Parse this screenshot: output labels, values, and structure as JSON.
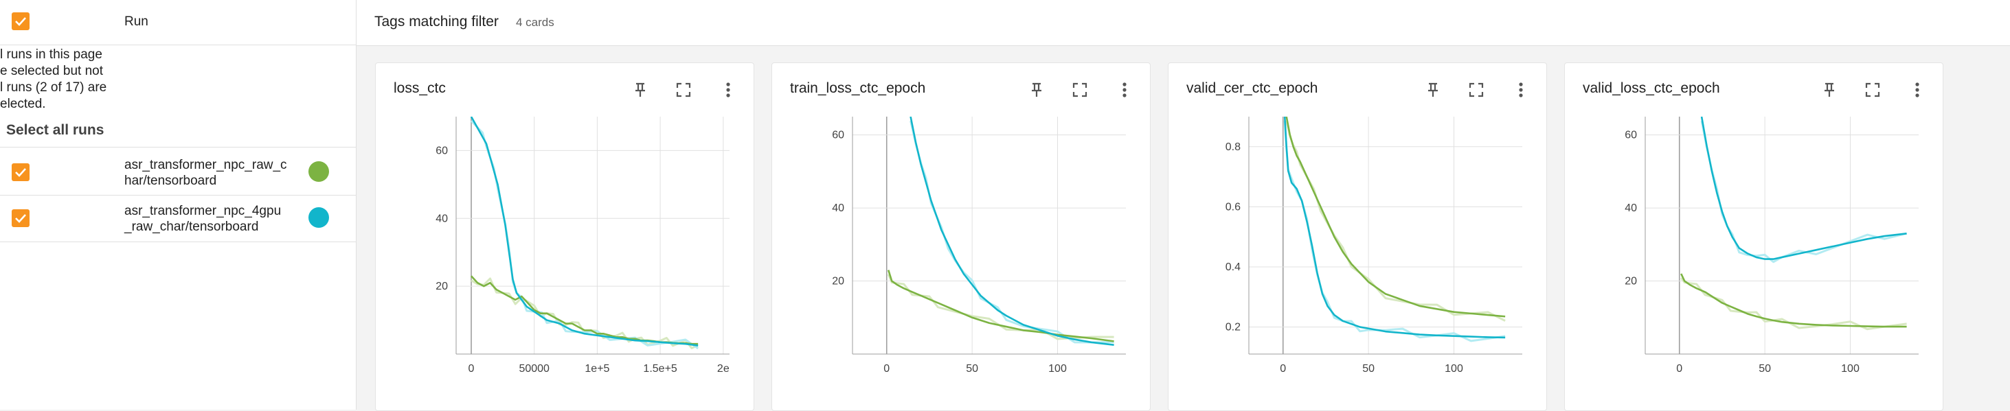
{
  "sidebar": {
    "header": {
      "label": "Run"
    },
    "notice": [
      "l runs in this page",
      "e selected but not",
      "l runs (2 of 17) are",
      "elected."
    ],
    "select_all": "Select all runs",
    "runs": [
      {
        "name_lines": [
          "asr_transformer_npc_raw_c",
          "har/tensorboard"
        ],
        "color": "#7cb342"
      },
      {
        "name_lines": [
          "asr_transformer_npc_4gpu",
          "_raw_char/tensorboard"
        ],
        "color": "#12b5cb"
      }
    ]
  },
  "topbar": {
    "title": "Tags matching filter",
    "count": "4 cards"
  },
  "colors": {
    "accent": "#f7931e",
    "run1": "#7cb342",
    "run2": "#12b5cb",
    "run1_light": "#d7e8c0",
    "run2_light": "#b2ebf2"
  },
  "icons": {
    "pin": "pin-icon",
    "fullscreen": "fullscreen-icon",
    "menu": "more-vert-icon"
  },
  "chart_data": [
    {
      "type": "line",
      "title": "loss_ctc",
      "xlim": [
        -12000,
        205000
      ],
      "ylim": [
        0,
        70
      ],
      "x_ticks": [
        0,
        50000,
        100000,
        150000,
        200000
      ],
      "x_tick_labels": [
        "0",
        "50000",
        "1e+5",
        "1.5e+5",
        "2e"
      ],
      "y_ticks": [
        0,
        20,
        40,
        60
      ],
      "y_tick_labels": [
        "",
        "20",
        "40",
        "60"
      ],
      "grid": true,
      "series": [
        {
          "color_key": "run1",
          "x": [
            0,
            5000,
            10000,
            15000,
            20000,
            25000,
            30000,
            35000,
            40000,
            45000,
            50000,
            55000,
            60000,
            65000,
            70000,
            75000,
            80000,
            85000,
            90000,
            95000,
            100000,
            105000,
            110000,
            115000,
            120000,
            125000,
            130000,
            135000,
            140000,
            145000,
            150000,
            155000,
            160000,
            165000,
            170000,
            175000,
            180000
          ],
          "y": [
            23,
            21,
            20,
            21,
            19,
            18,
            17,
            16,
            17,
            15,
            13,
            12,
            12,
            11,
            10,
            9,
            9,
            8,
            7,
            7,
            6,
            6,
            5.5,
            5,
            5,
            4.5,
            4.5,
            4,
            4,
            3.8,
            3.5,
            3.5,
            3.3,
            3.2,
            3.2,
            3,
            3
          ]
        },
        {
          "color_key": "run2",
          "x": [
            0,
            3000,
            6000,
            9000,
            12000,
            15000,
            18000,
            21000,
            24000,
            27000,
            30000,
            33000,
            36000,
            40000,
            44000,
            48000,
            52000,
            56000,
            60000,
            65000,
            70000,
            75000,
            80000,
            90000,
            100000,
            110000,
            120000,
            130000,
            140000,
            150000,
            160000,
            170000,
            180000
          ],
          "y": [
            70,
            68,
            66,
            64,
            62,
            58,
            54,
            50,
            44,
            38,
            30,
            22,
            18,
            16,
            14,
            13,
            12,
            11,
            10,
            9.5,
            9,
            8,
            7,
            6,
            5.5,
            5,
            4.5,
            4,
            3.8,
            3.5,
            3.2,
            3,
            2.5
          ]
        }
      ]
    },
    {
      "type": "line",
      "title": "train_loss_ctc_epoch",
      "xlim": [
        -20,
        140
      ],
      "ylim": [
        0,
        65
      ],
      "x_ticks": [
        0,
        50,
        100
      ],
      "x_tick_labels": [
        "0",
        "50",
        "100"
      ],
      "y_ticks": [
        0,
        20,
        40,
        60
      ],
      "y_tick_labels": [
        "",
        "20",
        "40",
        "60"
      ],
      "grid": true,
      "series": [
        {
          "color_key": "run1",
          "x": [
            1,
            3,
            6,
            10,
            15,
            20,
            25,
            30,
            40,
            50,
            60,
            70,
            80,
            90,
            100,
            110,
            120,
            133
          ],
          "y": [
            23,
            20,
            19,
            18,
            17,
            16,
            15,
            14,
            12,
            10,
            8.5,
            7.5,
            6.5,
            6,
            5.3,
            4.8,
            4.3,
            3.5
          ]
        },
        {
          "color_key": "run2",
          "x": [
            14,
            17,
            20,
            23,
            26,
            29,
            32,
            36,
            40,
            45,
            50,
            55,
            60,
            65,
            70,
            80,
            90,
            100,
            110,
            120,
            133
          ],
          "y": [
            65,
            58,
            52,
            47,
            42,
            38,
            34,
            30,
            26,
            22,
            19,
            16,
            14,
            12,
            10.5,
            8,
            6.5,
            5,
            4,
            3.2,
            2.5
          ]
        }
      ]
    },
    {
      "type": "line",
      "title": "valid_cer_ctc_epoch",
      "xlim": [
        -20,
        140
      ],
      "ylim": [
        0.11,
        0.9
      ],
      "x_ticks": [
        0,
        50,
        100
      ],
      "x_tick_labels": [
        "0",
        "50",
        "100"
      ],
      "y_ticks": [
        0.2,
        0.4,
        0.6,
        0.8
      ],
      "y_tick_labels": [
        "0.2",
        "0.4",
        "0.6",
        "0.8"
      ],
      "grid": true,
      "series": [
        {
          "color_key": "run1",
          "x": [
            2,
            4,
            6,
            8,
            10,
            14,
            18,
            22,
            26,
            30,
            35,
            40,
            45,
            50,
            60,
            70,
            80,
            90,
            100,
            110,
            120,
            130
          ],
          "y": [
            0.9,
            0.84,
            0.8,
            0.77,
            0.75,
            0.7,
            0.65,
            0.6,
            0.55,
            0.5,
            0.45,
            0.41,
            0.38,
            0.35,
            0.31,
            0.29,
            0.27,
            0.26,
            0.25,
            0.245,
            0.24,
            0.235
          ]
        },
        {
          "color_key": "run2",
          "x": [
            1,
            2,
            3,
            5,
            8,
            11,
            14,
            17,
            20,
            23,
            26,
            30,
            35,
            40,
            45,
            50,
            60,
            70,
            80,
            90,
            100,
            110,
            120,
            130
          ],
          "y": [
            0.9,
            0.8,
            0.72,
            0.68,
            0.66,
            0.62,
            0.55,
            0.47,
            0.38,
            0.31,
            0.27,
            0.24,
            0.22,
            0.21,
            0.2,
            0.195,
            0.185,
            0.18,
            0.175,
            0.172,
            0.17,
            0.168,
            0.166,
            0.165
          ]
        }
      ]
    },
    {
      "type": "line",
      "title": "valid_loss_ctc_epoch",
      "xlim": [
        -20,
        140
      ],
      "ylim": [
        0,
        65
      ],
      "x_ticks": [
        0,
        50,
        100
      ],
      "x_tick_labels": [
        "0",
        "50",
        "100"
      ],
      "y_ticks": [
        0,
        20,
        40,
        60
      ],
      "y_tick_labels": [
        "",
        "20",
        "40",
        "60"
      ],
      "grid": true,
      "series": [
        {
          "color_key": "run1",
          "x": [
            1,
            3,
            6,
            10,
            15,
            20,
            25,
            30,
            35,
            40,
            45,
            50,
            55,
            60,
            70,
            80,
            90,
            100,
            110,
            120,
            133
          ],
          "y": [
            22,
            20,
            19,
            18,
            17,
            15.5,
            14,
            13,
            12,
            11,
            10.3,
            9.7,
            9.2,
            8.8,
            8.3,
            8,
            7.8,
            7.7,
            7.6,
            7.5,
            7.5
          ]
        },
        {
          "color_key": "run2",
          "x": [
            13,
            16,
            19,
            22,
            25,
            28,
            31,
            35,
            40,
            45,
            50,
            55,
            60,
            70,
            80,
            90,
            100,
            110,
            120,
            133
          ],
          "y": [
            65,
            57,
            50,
            44,
            39,
            35,
            32,
            29,
            27.5,
            26.5,
            26,
            26,
            26.5,
            27.5,
            28.5,
            29.5,
            30.5,
            31.5,
            32.3,
            33
          ]
        }
      ]
    }
  ]
}
